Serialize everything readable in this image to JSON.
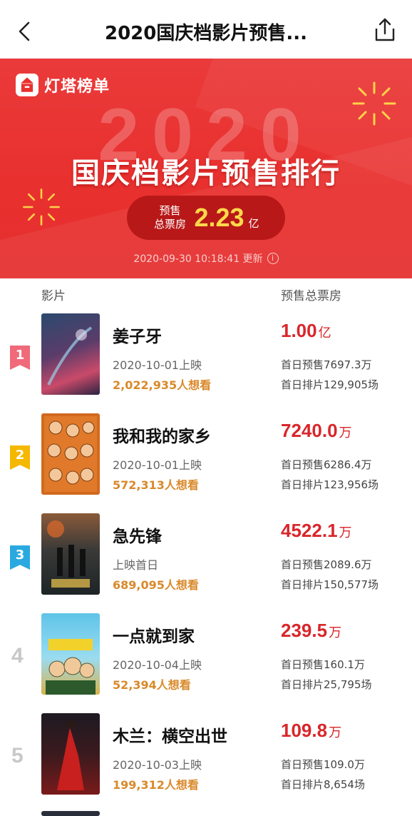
{
  "nav": {
    "title": "2020国庆档影片预售..."
  },
  "banner": {
    "brand": "灯塔榜单",
    "year": "2020",
    "headline": "国庆档影片预售排行",
    "total_label_1": "预售",
    "total_label_2": "总票房",
    "total_value": "2.23",
    "total_unit": "亿",
    "updated": "2020-09-30 10:18:41 更新",
    "info": "i"
  },
  "list": {
    "col_movie": "影片",
    "col_box": "预售总票房",
    "rows": [
      {
        "rank": "1",
        "title": "姜子牙",
        "date": "2020-10-01上映",
        "want": "2,022,935人想看",
        "box": "1.00",
        "box_unit": "亿",
        "presale": "首日预售7697.3万",
        "sched": "首日排片129,905场",
        "flag_color": "#f06a7a"
      },
      {
        "rank": "2",
        "title": "我和我的家乡",
        "date": "2020-10-01上映",
        "want": "572,313人想看",
        "box": "7240.0",
        "box_unit": "万",
        "presale": "首日预售6286.4万",
        "sched": "首日排片123,956场",
        "flag_color": "#f5b800"
      },
      {
        "rank": "3",
        "title": "急先锋",
        "date": "上映首日",
        "want": "689,095人想看",
        "box": "4522.1",
        "box_unit": "万",
        "presale": "首日预售2089.6万",
        "sched": "首日排片150,577场",
        "flag_color": "#2aa9e0"
      },
      {
        "rank": "4",
        "title": "一点就到家",
        "date": "2020-10-04上映",
        "want": "52,394人想看",
        "box": "239.5",
        "box_unit": "万",
        "presale": "首日预售160.1万",
        "sched": "首日排片25,795场"
      },
      {
        "rank": "5",
        "title": "木兰：横空出世",
        "date": "2020-10-03上映",
        "want": "199,312人想看",
        "box": "109.8",
        "box_unit": "万",
        "presale": "首日预售109.0万",
        "sched": "首日排片8,654场"
      }
    ]
  }
}
